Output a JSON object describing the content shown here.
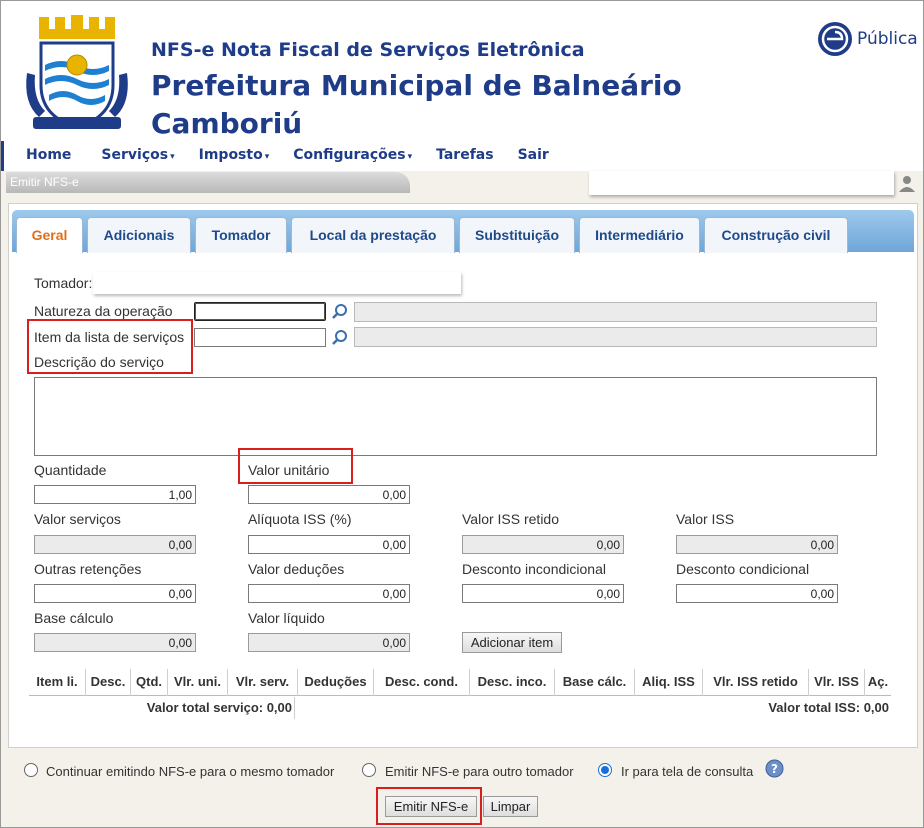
{
  "header": {
    "system_title": "NFS-e Nota Fiscal de Serviços Eletrônica",
    "org_title": "Prefeitura Municipal de Balneário Camboriú",
    "vendor_name": "Pública"
  },
  "nav": {
    "items": [
      {
        "label": "Home"
      },
      {
        "label": "Serviços",
        "caret": "▾"
      },
      {
        "label": "Imposto",
        "caret": "▾"
      },
      {
        "label": "Configurações",
        "caret": "▾"
      },
      {
        "label": "Tarefas"
      },
      {
        "label": "Sair"
      }
    ]
  },
  "breadcrumb": "Emitir NFS-e",
  "tabs": [
    {
      "label": "Geral",
      "active": true
    },
    {
      "label": "Adicionais"
    },
    {
      "label": "Tomador"
    },
    {
      "label": "Local da prestação"
    },
    {
      "label": "Substituição"
    },
    {
      "label": "Intermediário"
    },
    {
      "label": "Construção civil"
    }
  ],
  "form": {
    "tomador_label": "Tomador:",
    "natureza_label": "Natureza da operação",
    "item_lista_label": "Item da lista de serviços",
    "descricao_label": "Descrição do serviço",
    "quantidade_label": "Quantidade",
    "quantidade_value": "1,00",
    "valor_unitario_label": "Valor unitário",
    "valor_unitario_value": "0,00",
    "valor_servicos_label": "Valor serviços",
    "valor_servicos_value": "0,00",
    "aliquota_label": "Alíquota ISS (%)",
    "aliquota_value": "0,00",
    "iss_retido_label": "Valor ISS retido",
    "iss_retido_value": "0,00",
    "valor_iss_label": "Valor ISS",
    "valor_iss_value": "0,00",
    "outras_retencoes_label": "Outras retenções",
    "outras_retencoes_value": "0,00",
    "deducoes_label": "Valor deduções",
    "deducoes_value": "0,00",
    "desc_incond_label": "Desconto incondicional",
    "desc_incond_value": "0,00",
    "desc_cond_label": "Desconto condicional",
    "desc_cond_value": "0,00",
    "base_calculo_label": "Base cálculo",
    "base_calculo_value": "0,00",
    "valor_liquido_label": "Valor líquido",
    "valor_liquido_value": "0,00",
    "add_item_label": "Adicionar item"
  },
  "grid": {
    "columns": [
      "Item li.",
      "Desc.",
      "Qtd.",
      "Vlr. uni.",
      "Vlr. serv.",
      "Deduções",
      "Desc. cond.",
      "Desc. inco.",
      "Base cálc.",
      "Aliq. ISS",
      "Vlr. ISS retido",
      "Vlr. ISS",
      "Aç."
    ],
    "total_servico": "Valor total serviço: 0,00",
    "total_iss": "Valor total ISS: 0,00"
  },
  "options": [
    {
      "label": "Continuar emitindo NFS-e para o mesmo tomador",
      "checked": false
    },
    {
      "label": "Emitir NFS-e para outro tomador",
      "checked": false
    },
    {
      "label": "Ir para tela de consulta",
      "checked": true
    }
  ],
  "actions": {
    "emit_label": "Emitir NFS-e",
    "clear_label": "Limpar"
  },
  "colors": {
    "brand": "#1f3c88",
    "active_tab": "#e0701a",
    "highlight": "#d62020"
  }
}
